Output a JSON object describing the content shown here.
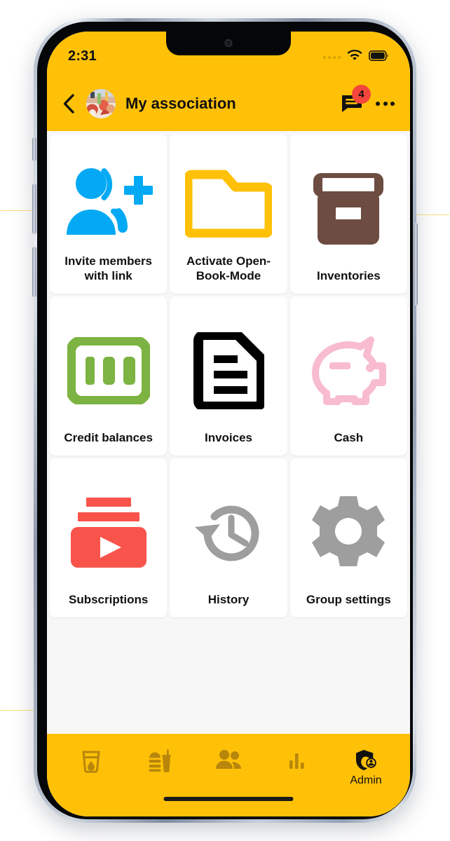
{
  "theme": {
    "brand_yellow": "#FFC107",
    "screen_bg": "#f7f7f7",
    "tile_bg": "#ffffff",
    "badge_red": "#F4463C",
    "text_dark": "#111111"
  },
  "status_bar": {
    "time": "2:31",
    "signal_icon": "signal-dots-icon",
    "wifi_icon": "wifi-icon",
    "battery_icon": "battery-full-icon"
  },
  "app_bar": {
    "back_icon": "back-chevron-icon",
    "avatar_icon": "group-avatar-photo",
    "title": "My association",
    "chat_icon": "chat-bubble-icon",
    "chat_badge_count": "4",
    "overflow_icon": "kebab-menu-icon"
  },
  "grid": {
    "tiles": [
      {
        "label": "Invite members with link",
        "icon": "person-add-icon",
        "color": "#03A9F4"
      },
      {
        "label": "Activate Open-Book-Mode",
        "icon": "folder-open-icon",
        "color": "#FFC107"
      },
      {
        "label": "Inventories",
        "icon": "archive-box-icon",
        "color": "#6D4C41"
      },
      {
        "label": "Credit balances",
        "icon": "money-100-icon",
        "color": "#7CB342"
      },
      {
        "label": "Invoices",
        "icon": "document-lines-icon",
        "color": "#000000"
      },
      {
        "label": "Cash",
        "icon": "piggy-bank-icon",
        "color": "#F8BBD0"
      },
      {
        "label": "Subscriptions",
        "icon": "subscriptions-play-icon",
        "color": "#F9544B"
      },
      {
        "label": "History",
        "icon": "history-clock-icon",
        "color": "#9E9E9E"
      },
      {
        "label": "Group settings",
        "icon": "gear-icon",
        "color": "#9E9E9E"
      }
    ]
  },
  "bottom_nav": {
    "items": [
      {
        "label": "",
        "icon": "drink-glass-icon",
        "active": false
      },
      {
        "label": "",
        "icon": "fast-food-icon",
        "active": false
      },
      {
        "label": "",
        "icon": "people-icon",
        "active": false
      },
      {
        "label": "",
        "icon": "bar-chart-icon",
        "active": false
      },
      {
        "label": "Admin",
        "icon": "admin-shield-icon",
        "active": true
      }
    ]
  }
}
